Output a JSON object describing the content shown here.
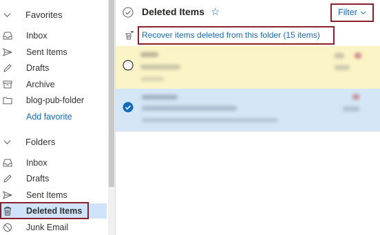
{
  "sidebar": {
    "favorites": {
      "heading": "Favorites",
      "items": [
        {
          "label": "Inbox",
          "icon": "inbox-icon"
        },
        {
          "label": "Sent Items",
          "icon": "send-icon"
        },
        {
          "label": "Drafts",
          "icon": "pencil-icon"
        },
        {
          "label": "Archive",
          "icon": "archive-icon"
        },
        {
          "label": "blog-pub-folder",
          "icon": "folder-icon"
        }
      ],
      "add_favorite": "Add favorite"
    },
    "folders": {
      "heading": "Folders",
      "items": [
        {
          "label": "Inbox",
          "icon": "inbox-icon"
        },
        {
          "label": "Drafts",
          "icon": "pencil-icon"
        },
        {
          "label": "Sent Items",
          "icon": "send-icon"
        },
        {
          "label": "Deleted Items",
          "icon": "trash-icon",
          "selected": true
        },
        {
          "label": "Junk Email",
          "icon": "block-icon"
        }
      ]
    }
  },
  "main": {
    "folder_title": "Deleted Items",
    "filter_label": "Filter",
    "recover_link": "Recover items deleted from this folder (15 items)",
    "messages": [
      {
        "state": "unselected",
        "highlight": "yellow"
      },
      {
        "state": "selected",
        "highlight": "blue"
      }
    ]
  },
  "colors": {
    "accent": "#0f6cbd",
    "highlight_box": "#8b1e2d",
    "selected_nav": "#cfe4fa",
    "row_yellow": "#fbf4c6",
    "row_blue": "#d5e6f6"
  }
}
